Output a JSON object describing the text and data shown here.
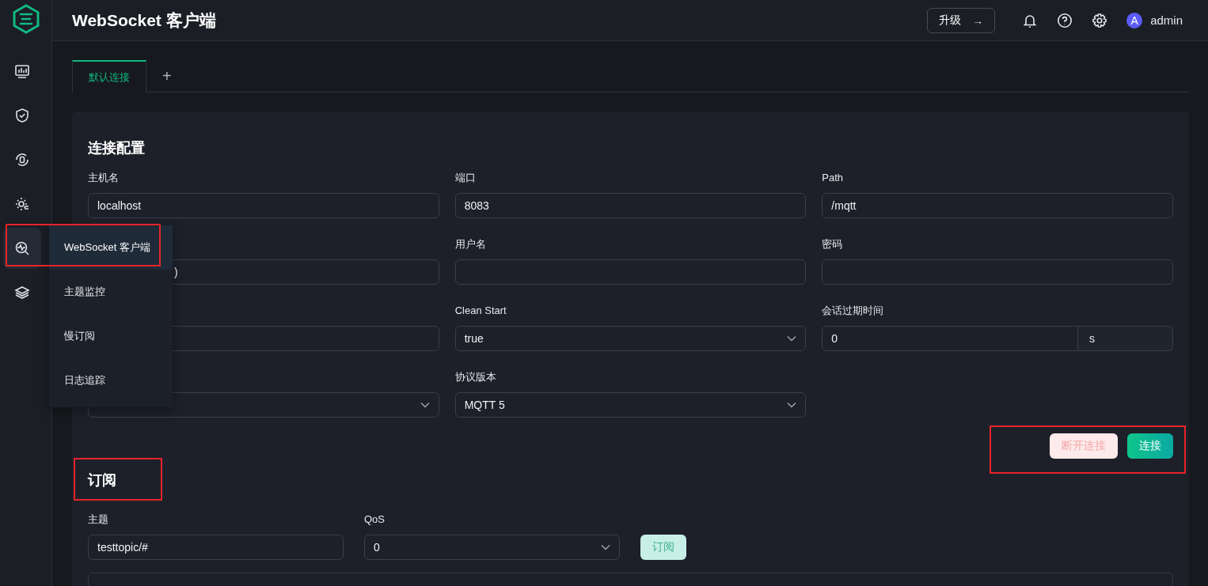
{
  "sidebar": {
    "items": [
      {
        "kind": "monitor",
        "selected": false
      },
      {
        "kind": "shield",
        "selected": false
      },
      {
        "kind": "sync",
        "selected": false
      },
      {
        "kind": "gear",
        "selected": false
      },
      {
        "kind": "diagnose",
        "selected": true
      },
      {
        "kind": "layers",
        "selected": false
      }
    ]
  },
  "header": {
    "title": "WebSocket 客户端",
    "upgrade_button": {
      "label": "升级",
      "arrow": "→"
    },
    "user": {
      "avatar": "A",
      "name": "admin"
    }
  },
  "tabs": [
    {
      "label": "默认连接",
      "selected": true
    }
  ],
  "add_tab": "+",
  "flyout": {
    "items": [
      {
        "label": "WebSocket 客户端",
        "selected": true,
        "highlighted": true
      },
      {
        "label": "主题监控",
        "selected": false,
        "highlighted": false
      },
      {
        "label": "慢订阅",
        "selected": false,
        "highlighted": false
      },
      {
        "label": "日志追踪",
        "selected": false,
        "highlighted": false
      }
    ]
  },
  "connection": {
    "title": "连接配置",
    "fields": [
      {
        "kind": "input",
        "label": "主机名",
        "value": "localhost"
      },
      {
        "kind": "input",
        "label": "端口",
        "value": "8083"
      },
      {
        "kind": "input",
        "label": "Path",
        "value": "/mqtt"
      },
      {
        "kind": "input",
        "value": ")"
      },
      {
        "kind": "input",
        "label": "用户名"
      },
      {
        "kind": "input",
        "label": "密码"
      },
      {
        "kind": "input"
      },
      {
        "kind": "select",
        "label": "Clean Start",
        "value": "true"
      },
      {
        "kind": "suffix",
        "label": "会话过期时间",
        "value": "0",
        "suffix": "s"
      },
      {
        "kind": "select"
      },
      {
        "kind": "select",
        "label": "协议版本",
        "value": "MQTT 5"
      }
    ],
    "buttons": [
      {
        "kind": "danger",
        "label": "断开连接",
        "disabled": true
      },
      {
        "kind": "primary",
        "label": "连接",
        "disabled": false
      }
    ],
    "buttons_highlighted": true
  },
  "subscribe": {
    "title": "订阅",
    "highlighted": true,
    "topic": {
      "label": "主题",
      "value": "testtopic/#"
    },
    "qos": {
      "label": "QoS",
      "value": "0"
    },
    "button": {
      "label": "订阅",
      "disabled": true
    }
  }
}
